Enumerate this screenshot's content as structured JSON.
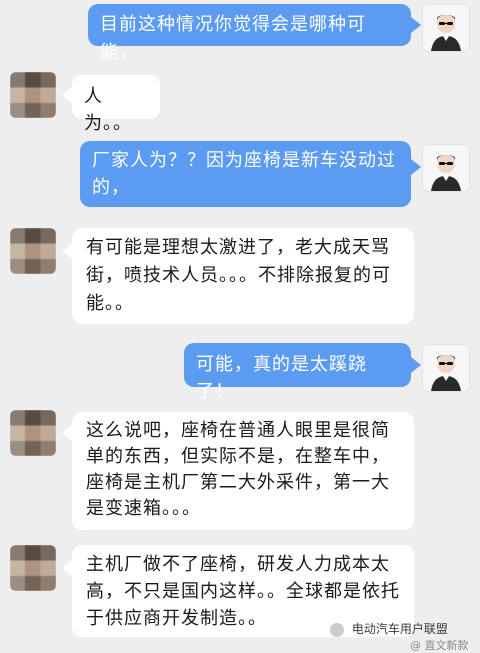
{
  "messages": [
    {
      "side": "right",
      "text": "目前这种情况你觉得会是哪种可能，"
    },
    {
      "side": "left",
      "text": "人为。。"
    },
    {
      "side": "right",
      "text": "厂家人为？？因为座椅是新车没动过的，"
    },
    {
      "side": "left",
      "text": "有可能是理想太激进了，老大成天骂街，喷技术人员。。。不排除报复的可能。。"
    },
    {
      "side": "right",
      "text": "可能，真的是太蹊跷了！"
    },
    {
      "side": "left",
      "text": "这么说吧，座椅在普通人眼里是很简单的东西，但实际不是，在整车中，座椅是主机厂第二大外采件，第一大是变速箱。。。"
    },
    {
      "side": "left",
      "text": "主机厂做不了座椅，研发人力成本太高，不只是国内这样。。全球都是依托于供应商开发制造。。"
    }
  ],
  "watermark": {
    "title": "电动汽车用户联盟",
    "sub": "@ 直文新款"
  },
  "colors": {
    "right_bubble": "#5b9cf2",
    "left_bubble": "#ffffff",
    "background": "#eeeeee"
  }
}
